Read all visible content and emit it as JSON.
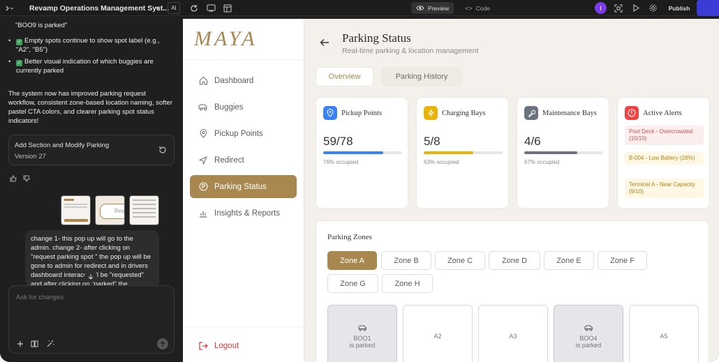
{
  "topbar": {
    "project_title": "Revamp Operations Management Syst...",
    "ai_badge": "AI",
    "preview_label": "Preview",
    "code_label": "Code",
    "avatar_initial": "I",
    "publish_label": "Publish"
  },
  "chat": {
    "quote_line": "\"BOO9 is parked\"",
    "bullets": [
      "Empty spots continue to show spot label (e.g., \"A2\", \"B5\")",
      "Better visual indication of which buggies are currently parked"
    ],
    "summary": "The system now has improved parking request workflow, consistent zone-based location naming, softer pastel CTA colors, and clearer parking spot status indicators!",
    "version_title": "Add Section and Modify Parking",
    "version_number": "Version 27",
    "thumb_text": "Req",
    "user_message": "change 1- this pop up will go to the admin. change 2- after clicking on \"request parking spot \" the pop up will be gone to admin for redirect and in drivers dashboard interace will be \"requested\" and after clicking on \"parked\" the",
    "input_placeholder": "Ask for changes"
  },
  "app": {
    "logo": "MAYA",
    "nav": [
      {
        "label": "Dashboard",
        "icon": "home-icon"
      },
      {
        "label": "Buggies",
        "icon": "buggy-icon"
      },
      {
        "label": "Pickup Points",
        "icon": "map-pin-icon"
      },
      {
        "label": "Redirect",
        "icon": "navigation-arrow-icon"
      },
      {
        "label": "Parking Status",
        "icon": "parking-icon",
        "active": true
      },
      {
        "label": "Insights & Reports",
        "icon": "chart-icon"
      }
    ],
    "logout_label": "Logout",
    "page_title": "Parking Status",
    "page_subtitle": "Real-time parking & location management",
    "tabs": [
      {
        "label": "Overview",
        "active": true
      },
      {
        "label": "Parking History",
        "active": false
      }
    ],
    "cards": [
      {
        "title": "Pickup Points",
        "value": "59/78",
        "sub": "76% occupied",
        "fill": 0.76,
        "color": "#3b82f6"
      },
      {
        "title": "Charging Bays",
        "value": "5/8",
        "sub": "63% occupied",
        "fill": 0.63,
        "color": "#eab308"
      },
      {
        "title": "Maintenance Bays",
        "value": "4/6",
        "sub": "67% occupied",
        "fill": 0.67,
        "color": "#6b7280"
      }
    ],
    "alerts": {
      "title": "Active Alerts",
      "items": [
        {
          "text": "Pool Deck - Overcrowded (10/10)",
          "level": "danger"
        },
        {
          "text": "B-004 - Low Battery (28%)",
          "level": "warning"
        },
        {
          "text": "Terminal A - Near Capacity (9/10)",
          "level": "warning"
        }
      ]
    },
    "zones_title": "Parking Zones",
    "zones": [
      "Zone A",
      "Zone B",
      "Zone C",
      "Zone D",
      "Zone E",
      "Zone F",
      "Zone G",
      "Zone H"
    ],
    "active_zone": "Zone A",
    "spots": [
      {
        "id": "BOO1",
        "status": "is parked",
        "occupied": true
      },
      {
        "id": "A2",
        "occupied": false
      },
      {
        "id": "A3",
        "occupied": false
      },
      {
        "id": "BOO4",
        "status": "is parked",
        "occupied": true
      },
      {
        "id": "A5",
        "occupied": false
      }
    ],
    "colors": {
      "accent": "#a8884f",
      "background": "#f4f1ec",
      "logout": "#d93636"
    }
  }
}
